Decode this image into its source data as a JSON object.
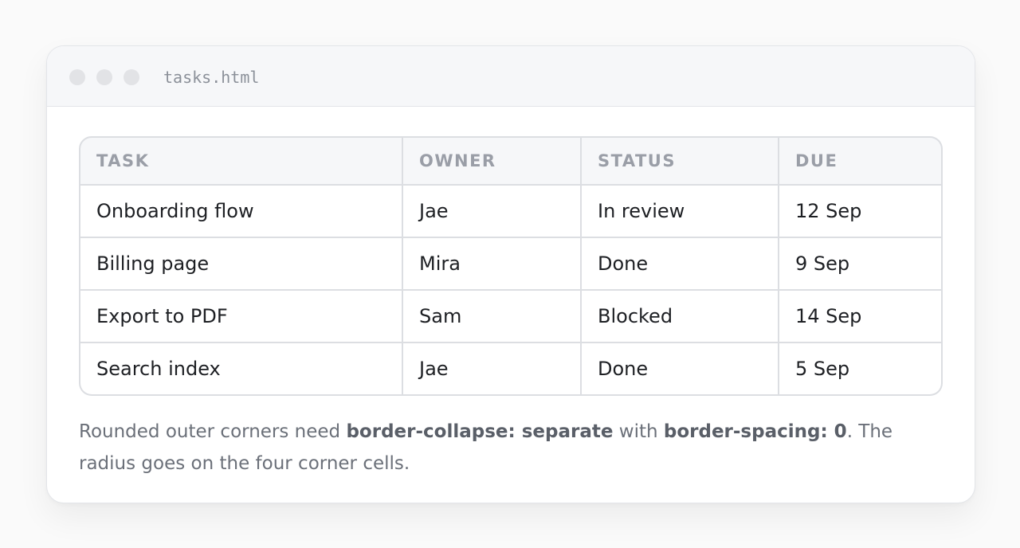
{
  "window": {
    "filename": "tasks.html"
  },
  "table": {
    "headers": [
      "TASK",
      "OWNER",
      "STATUS",
      "DUE"
    ],
    "rows": [
      [
        "Onboarding flow",
        "Jae",
        "In review",
        "12 Sep"
      ],
      [
        "Billing page",
        "Mira",
        "Done",
        "9 Sep"
      ],
      [
        "Export to PDF",
        "Sam",
        "Blocked",
        "14 Sep"
      ],
      [
        "Search index",
        "Jae",
        "Done",
        "5 Sep"
      ]
    ]
  },
  "note": {
    "part1": "Rounded outer corners need ",
    "bold1": "border-collapse: separate",
    "part2": " with ",
    "bold2": "border-spacing: 0",
    "part3": ". The radius goes on the four corner cells."
  },
  "colors": {
    "border": "#dcdee2",
    "header_bg": "#f6f7f9",
    "header_text": "#9a9ea7",
    "body_text": "#1d1f23",
    "note_text": "#6b7079"
  }
}
